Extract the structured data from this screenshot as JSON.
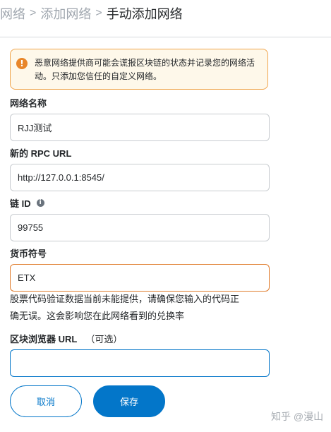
{
  "breadcrumb": {
    "items": [
      "网络",
      "添加网络",
      "手动添加网络"
    ],
    "separator": ">"
  },
  "warning": {
    "icon": "exclamation-circle-icon",
    "line1": "恶意网络提供商可能会谎报区块链的状态并记录您的网络活",
    "line2": "动。只添加您信任的自定义网络。"
  },
  "form": {
    "network_name": {
      "label": "网络名称",
      "value": "RJJ测试"
    },
    "rpc_url": {
      "label": "新的 RPC URL",
      "value": "http://127.0.0.1:8545/"
    },
    "chain_id": {
      "label": "链 ID",
      "value": "99755",
      "info_icon": "info-icon"
    },
    "currency_symbol": {
      "label": "货币符号",
      "value": "ETX"
    },
    "currency_hint_line1": "股票代码验证数据当前未能提供，请确保您输入的代码正",
    "currency_hint_line2": "确无误。这会影响您在此网络看到的兑换率",
    "explorer_url": {
      "label": "区块浏览器 URL",
      "optional": "（可选）",
      "value": ""
    }
  },
  "buttons": {
    "cancel": "取消",
    "save": "保存"
  },
  "watermark": "知乎 @漫山",
  "colors": {
    "accent": "#0376c9",
    "warning_border": "#f0a44b",
    "warning_bg": "#fef8ea",
    "error_border": "#e07b2b"
  }
}
